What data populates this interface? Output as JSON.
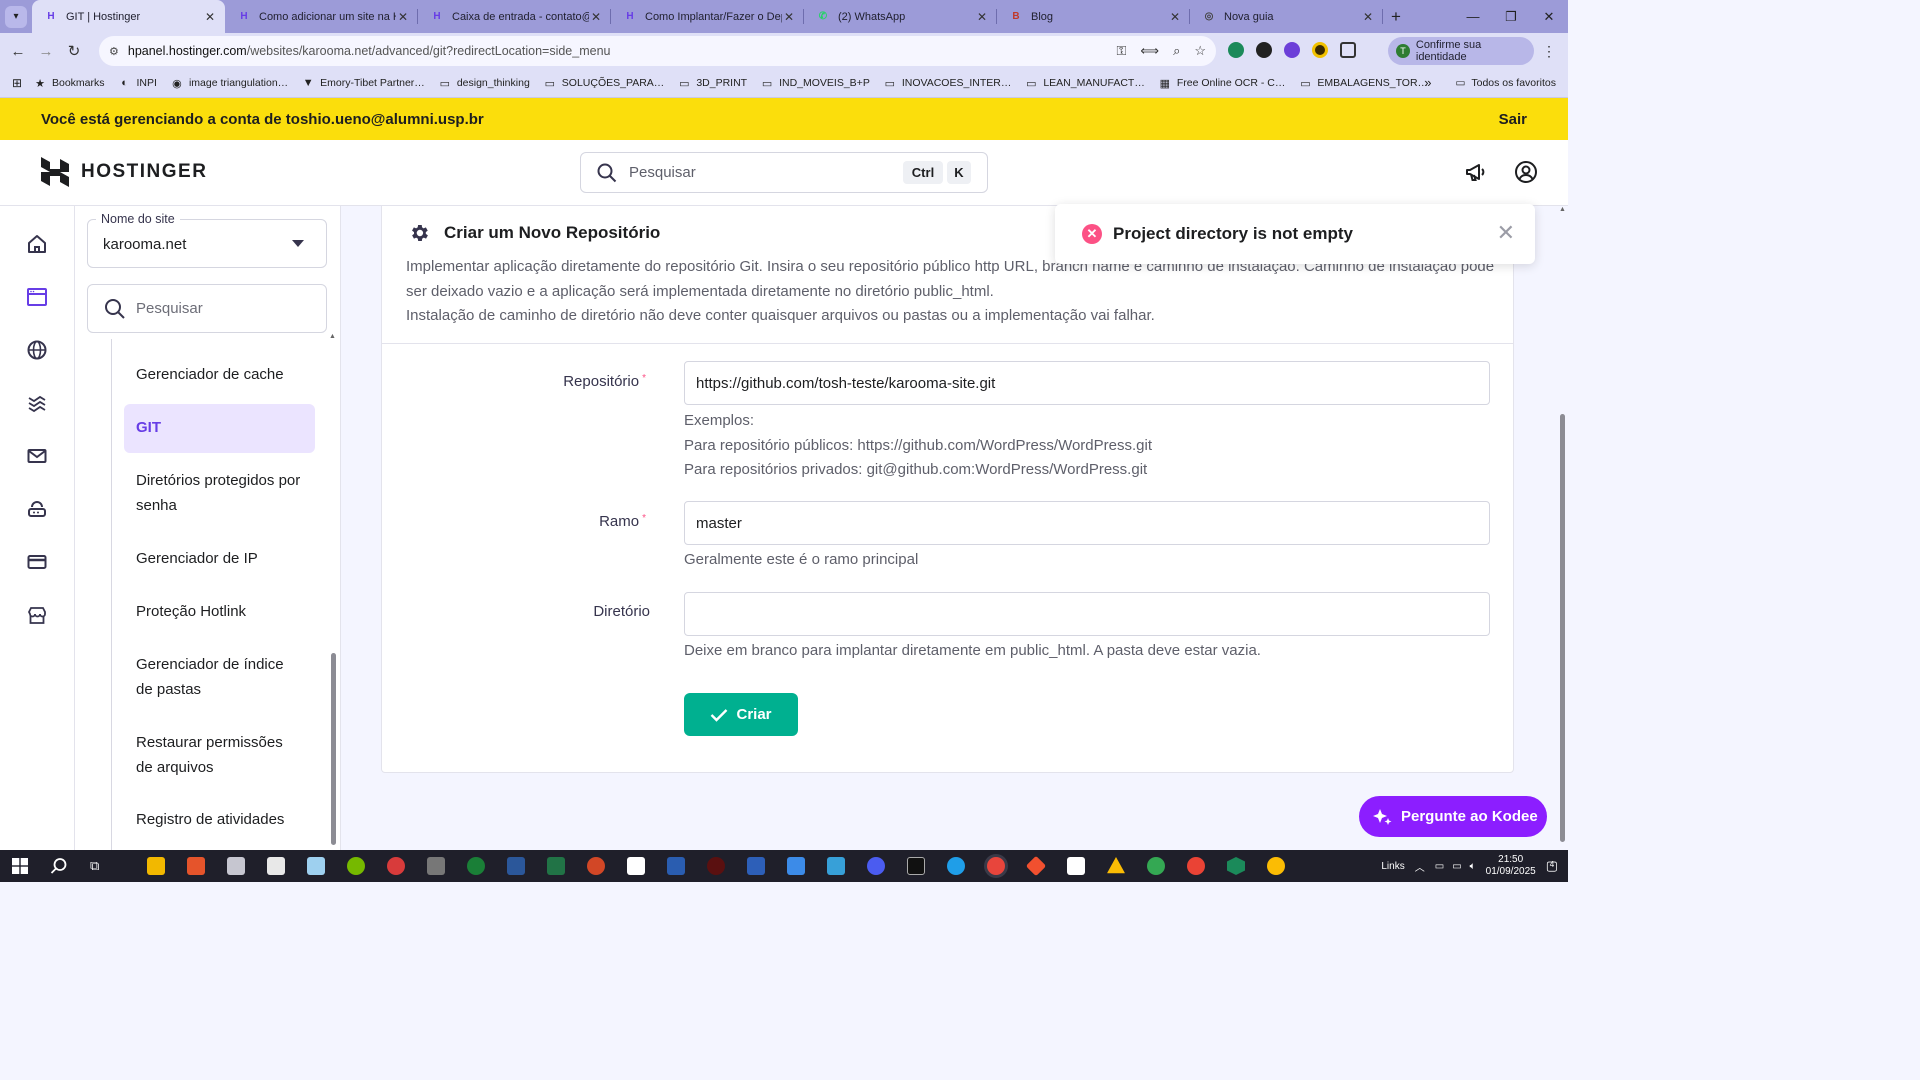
{
  "browser": {
    "tabs": [
      {
        "title": "GIT | Hostinger",
        "fav": "H",
        "fav_color": "#673de6",
        "active": true
      },
      {
        "title": "Como adicionar um site na Ho…",
        "fav": "H",
        "fav_color": "#673de6",
        "active": false
      },
      {
        "title": "Caixa de entrada - contato@to…",
        "fav": "H",
        "fav_color": "#673de6",
        "active": false
      },
      {
        "title": "Como Implantar/Fazer o Deplo…",
        "fav": "H",
        "fav_color": "#673de6",
        "active": false
      },
      {
        "title": "(2) WhatsApp",
        "fav": "✆",
        "fav_color": "#25d366",
        "active": false
      },
      {
        "title": "Blog",
        "fav": "B",
        "fav_color": "#c0392b",
        "active": false
      },
      {
        "title": "Nova guia",
        "fav": "◎",
        "fav_color": "#444444",
        "active": false
      }
    ],
    "url_host": "hpanel.hostinger.com",
    "url_path": "/websites/karooma.net/advanced/git?redirectLocation=side_menu",
    "confirm_identity": "Confirme sua identidade",
    "bookmarks": [
      {
        "label": "Bookmarks",
        "icon": "★"
      },
      {
        "label": "INPI",
        "icon": "◐"
      },
      {
        "label": "image triangulation…",
        "icon": "◉"
      },
      {
        "label": "Emory-Tibet Partner…",
        "icon": "▼"
      },
      {
        "label": "design_thinking",
        "icon": "▭"
      },
      {
        "label": "SOLUÇÕES_PARA…",
        "icon": "▭"
      },
      {
        "label": "3D_PRINT",
        "icon": "▭"
      },
      {
        "label": "IND_MOVEIS_B+P",
        "icon": "▭"
      },
      {
        "label": "INOVACOES_INTER…",
        "icon": "▭"
      },
      {
        "label": "LEAN_MANUFACT…",
        "icon": "▭"
      },
      {
        "label": "Free Online OCR - C…",
        "icon": "▦"
      },
      {
        "label": "EMBALAGENS_TOR…",
        "icon": "▭"
      }
    ],
    "all_bookmarks": "Todos os favoritos"
  },
  "banner": {
    "text": "Você está gerenciando a conta de toshio.ueno@alumni.usp.br",
    "exit": "Sair"
  },
  "header": {
    "brand": "HOSTINGER",
    "search_placeholder": "Pesquisar",
    "kbd_ctrl": "Ctrl",
    "kbd_k": "K"
  },
  "sidebar": {
    "site_label": "Nome do site",
    "site_value": "karooma.net",
    "search_placeholder": "Pesquisar",
    "items": [
      {
        "label": "Gerenciador de cache"
      },
      {
        "label": "GIT"
      },
      {
        "label": "Diretórios protegidos por senha"
      },
      {
        "label": "Gerenciador de IP"
      },
      {
        "label": "Proteção Hotlink"
      },
      {
        "label": "Gerenciador de índice de pastas"
      },
      {
        "label": "Restaurar permissões de arquivos"
      },
      {
        "label": "Registro de atividades"
      }
    ]
  },
  "card": {
    "title": "Criar um Novo Repositório",
    "desc_line1": "Implementar aplicação diretamente do repositório Git. Insira o seu repositório público http URL, branch name e caminho de instalação. Caminho de instalação pode ser deixado vazio e a aplicação será implementada diretamente no diretório public_html.",
    "desc_line2": "Instalação de caminho de diretório não deve conter quaisquer arquivos ou pastas ou a implementação vai falhar.",
    "repo_label": "Repositório",
    "repo_value": "https://github.com/tosh-teste/karooma-site.git",
    "examples_title": "Exemplos:",
    "example_public": "Para repositório públicos: https://github.com/WordPress/WordPress.git",
    "example_private": "Para repositórios privados: git@github.com:WordPress/WordPress.git",
    "branch_label": "Ramo",
    "branch_value": "master",
    "branch_help": "Geralmente este é o ramo principal",
    "dir_label": "Diretório",
    "dir_value": "",
    "dir_help": "Deixe em branco para implantar diretamente em public_html. A pasta deve estar vazia.",
    "create_button": "Criar"
  },
  "toast": {
    "message": "Project directory is not empty"
  },
  "kodee": {
    "label": "Pergunte ao Kodee"
  },
  "taskbar": {
    "links": "Links",
    "time": "21:50",
    "date": "01/09/2025",
    "notifications": "4"
  },
  "colors": {
    "primary": "#673de6",
    "success": "#00b090",
    "danger": "#fc5185",
    "banner": "#fbde0c",
    "kodee": "#8c1eff"
  }
}
